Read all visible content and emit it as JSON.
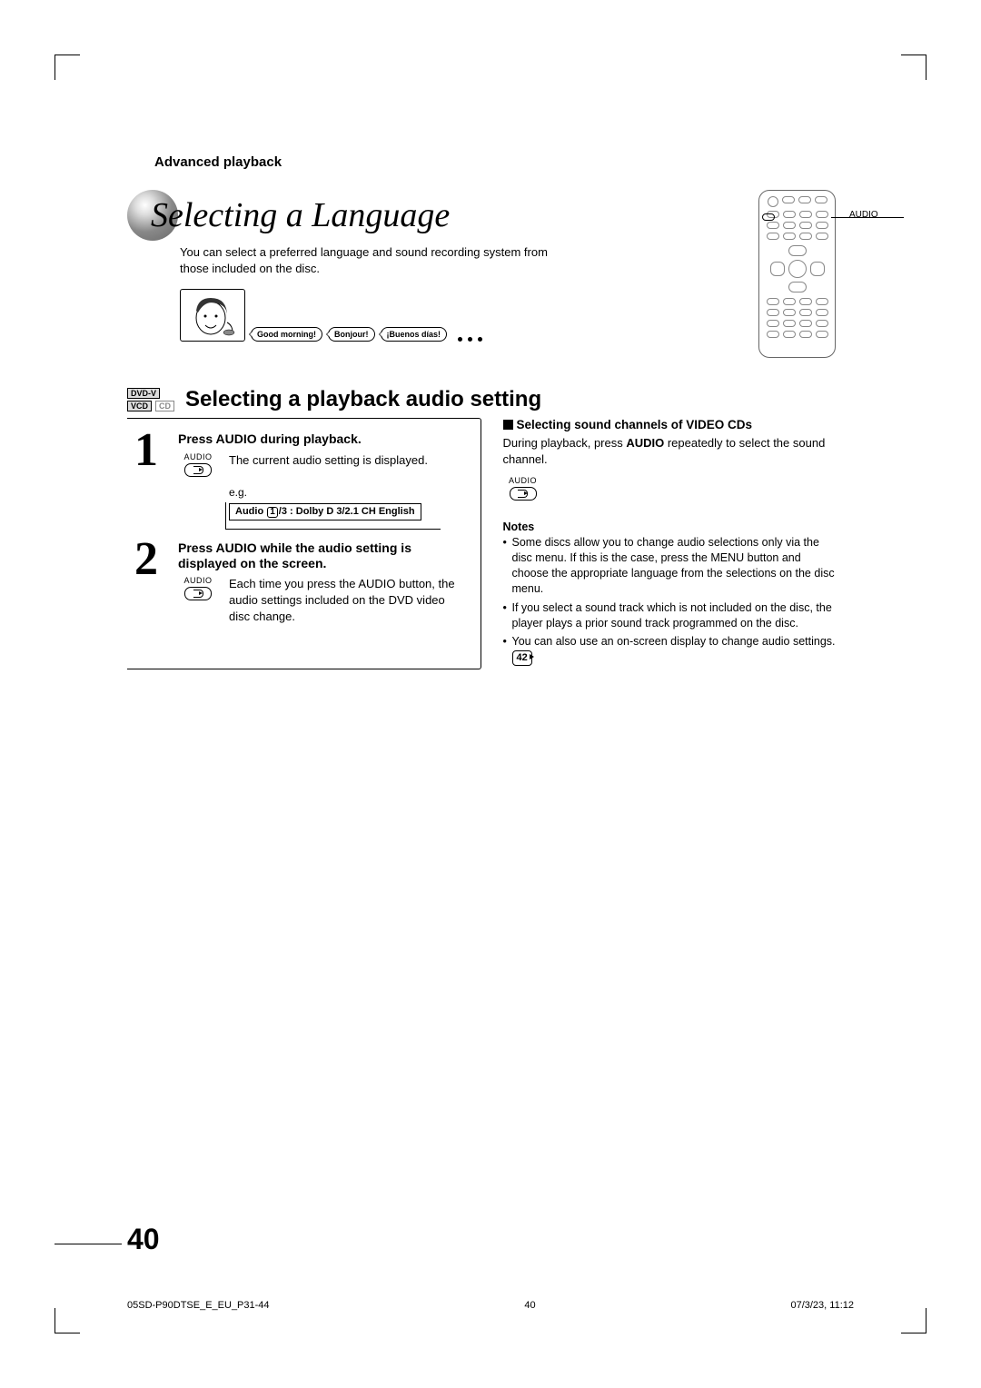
{
  "section_head": "Advanced playback",
  "title": "Selecting a Language",
  "intro": "You can select a preferred language and sound recording system from those included on the disc.",
  "bubbles": {
    "b1": "Good morning!",
    "b2": "Bonjour!",
    "b3": "¡Buenos días!"
  },
  "remote_label": "AUDIO",
  "badges": {
    "dvd": "DVD-V",
    "vcd": "VCD",
    "cd": "CD"
  },
  "subhead": "Selecting a playback audio setting",
  "step1": {
    "num": "1",
    "title": "Press AUDIO during playback.",
    "audio_label": "AUDIO",
    "text": "The current audio setting is displayed.",
    "eg": "e.g.",
    "osd_pre": "Audio",
    "osd_num": "1",
    "osd_post": "/3 :  Dolby D 3/2.1 CH English"
  },
  "step2": {
    "num": "2",
    "title": "Press AUDIO while the audio setting is displayed on the screen.",
    "audio_label": "AUDIO",
    "text": "Each time you press the AUDIO button, the audio settings included on the DVD video disc change."
  },
  "right": {
    "title": "Selecting sound channels of VIDEO CDs",
    "text_pre": "During playback, press ",
    "text_bold": "AUDIO",
    "text_post": " repeatedly to select the sound channel.",
    "audio_label": "AUDIO"
  },
  "notes": {
    "head": "Notes",
    "n1": "Some discs allow you to change audio selections only via the disc menu.  If this is the case, press the MENU button and choose the appropriate language from the selections on the disc menu.",
    "n2": "If you select a sound track which is not included on the disc, the player plays a prior sound track programmed on the disc.",
    "n3_pre": "You can also use an on-screen display to change audio settings. ",
    "n3_ref": "42"
  },
  "page_num": "40",
  "footer": {
    "left": "05SD-P90DTSE_E_EU_P31-44",
    "mid": "40",
    "right": "07/3/23, 11:12"
  }
}
